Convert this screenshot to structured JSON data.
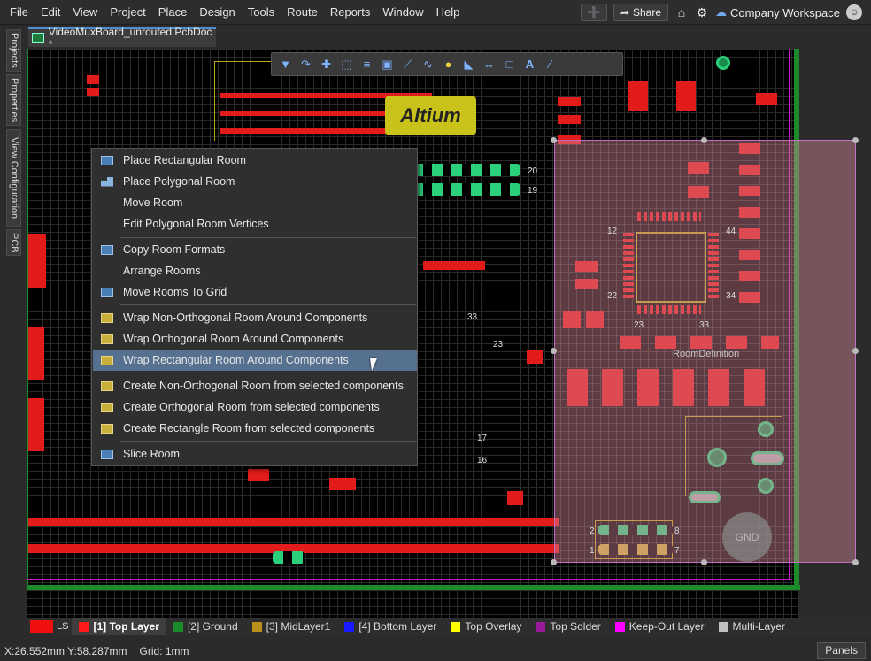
{
  "menubar": {
    "menus": [
      "File",
      "Edit",
      "View",
      "Project",
      "Place",
      "Design",
      "Tools",
      "Route",
      "Reports",
      "Window",
      "Help"
    ],
    "share_label": "Share",
    "workspace_label": "Company Workspace"
  },
  "side_panels": [
    "Projects",
    "Properties",
    "View Configuration",
    "PCB"
  ],
  "document_tab": {
    "title": "VideoMuxBoard_unrouted.PcbDoc *"
  },
  "toolbar": {
    "icons": [
      "filter-icon",
      "route-icon",
      "crosshair-icon",
      "select-rect-icon",
      "align-icon",
      "component-icon",
      "interactive-route-icon",
      "diff-pair-icon",
      "pin-icon",
      "polygon-icon",
      "dimension-icon",
      "region-icon",
      "text-icon",
      "line-icon"
    ]
  },
  "canvas": {
    "logo_text": "Altium",
    "room_label": "RoomDefinition",
    "gnd_label": "GND",
    "pin_labels": [
      "12",
      "44",
      "22",
      "34",
      "23",
      "33",
      "20",
      "19",
      "2",
      "1",
      "7",
      "8",
      "17",
      "16",
      "33",
      "23"
    ]
  },
  "context_menu": {
    "items": [
      {
        "label": "Place Rectangular Room",
        "icon": "rect-room"
      },
      {
        "label": "Place Polygonal Room",
        "icon": "poly-room"
      },
      {
        "label": "Move Room",
        "icon": "none"
      },
      {
        "label": "Edit Polygonal Room Vertices",
        "icon": "none"
      },
      {
        "label": "Copy Room Formats",
        "icon": "copy-room"
      },
      {
        "label": "Arrange Rooms",
        "icon": "none"
      },
      {
        "label": "Move Rooms To Grid",
        "icon": "grid-room"
      },
      {
        "label": "Wrap Non-Orthogonal Room Around Components",
        "icon": "wrap-nonortho"
      },
      {
        "label": "Wrap Orthogonal Room Around Components",
        "icon": "wrap-ortho"
      },
      {
        "label": "Wrap Rectangular Room Around Components",
        "icon": "wrap-rect",
        "highlighted": true
      },
      {
        "label": "Create Non-Orthogonal Room from selected components",
        "icon": "create-nonortho"
      },
      {
        "label": "Create Orthogonal Room from selected components",
        "icon": "create-ortho"
      },
      {
        "label": "Create Rectangle Room from selected components",
        "icon": "create-rect"
      },
      {
        "label": "Slice Room",
        "icon": "slice-room"
      }
    ]
  },
  "layer_bar": {
    "ls_label": "LS",
    "layers": [
      {
        "label": "[1] Top Layer",
        "color": "#ff1a1a",
        "active": true
      },
      {
        "label": "[2] Ground",
        "color": "#1a8a2a"
      },
      {
        "label": "[3] MidLayer1",
        "color": "#b8901a"
      },
      {
        "label": "[4] Bottom Layer",
        "color": "#1a1aff"
      },
      {
        "label": "Top Overlay",
        "color": "#ffff00"
      },
      {
        "label": "Top Solder",
        "color": "#9a1a9a"
      },
      {
        "label": "Keep-Out Layer",
        "color": "#ff00ff"
      },
      {
        "label": "Multi-Layer",
        "color": "#c0c0c0"
      }
    ]
  },
  "status": {
    "coords": "X:26.552mm Y:58.287mm",
    "grid": "Grid: 1mm",
    "panels_label": "Panels"
  }
}
